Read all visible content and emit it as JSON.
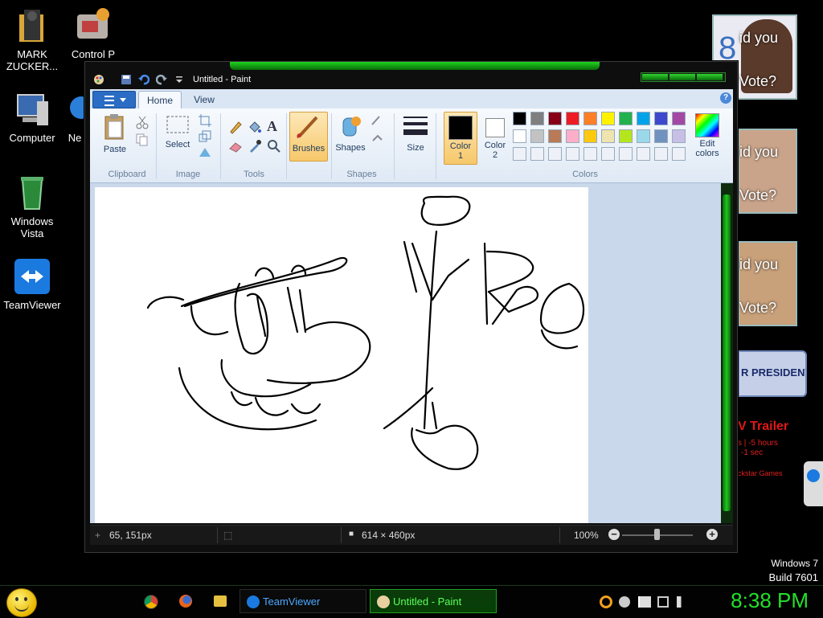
{
  "desktop": {
    "icons": [
      {
        "label": "MARK ZUCKER...",
        "icon": "user-folder-icon"
      },
      {
        "label": "Control P",
        "icon": "control-panel-icon"
      },
      {
        "label": "Computer",
        "icon": "computer-icon"
      },
      {
        "label": "Ne",
        "icon": "network-icon"
      },
      {
        "label": "Windows Vista",
        "icon": "recycle-bin-icon"
      },
      {
        "label": "TeamViewer",
        "icon": "teamviewer-icon"
      }
    ],
    "windows_version": "Windows 7",
    "build": "Build 7601"
  },
  "gadgets": {
    "vote1": "id you\nVote?",
    "vote1_number": "8",
    "vote2": "id you\nVote?",
    "vote3": "id you\nVote?",
    "president": "R PRESIDENT",
    "trailer_title": "V Trailer",
    "trailer_line1": "s | -5 hours",
    "trailer_line2": "-1 sec",
    "trailer_line3": "ckstar Games"
  },
  "paint": {
    "title": "Untitled - Paint",
    "tabs": [
      "Home",
      "View"
    ],
    "ribbon": {
      "clipboard": {
        "label": "Clipboard",
        "paste": "Paste"
      },
      "image": {
        "label": "Image",
        "select": "Select"
      },
      "tools": {
        "label": "Tools"
      },
      "brushes": "Brushes",
      "shapes": {
        "label": "Shapes",
        "button": "Shapes"
      },
      "size": "Size",
      "color1": "Color\n1",
      "color2": "Color\n2",
      "colors_label": "Colors",
      "edit_colors": "Edit\ncolors"
    },
    "palette_row1": [
      "#000000",
      "#7f7f7f",
      "#880015",
      "#ed1c24",
      "#ff7f27",
      "#fff200",
      "#22b14c",
      "#00a2e8",
      "#3f48cc",
      "#a349a4"
    ],
    "palette_row2": [
      "#ffffff",
      "#c3c3c3",
      "#b97a57",
      "#ffaec9",
      "#ffc90e",
      "#efe4b0",
      "#b5e61d",
      "#99d9ea",
      "#7092be",
      "#c8bfe7"
    ],
    "status": {
      "cursor_pos": "65, 151px",
      "canvas_size": "614 × 460px",
      "zoom": "100%"
    }
  },
  "taskbar": {
    "items": [
      {
        "label": "TeamViewer"
      },
      {
        "label": "Untitled - Paint"
      }
    ],
    "clock": "8:38 PM"
  },
  "colors": {
    "accent_green": "#22e02a",
    "ribbon_bg": "#dfe9f5"
  }
}
